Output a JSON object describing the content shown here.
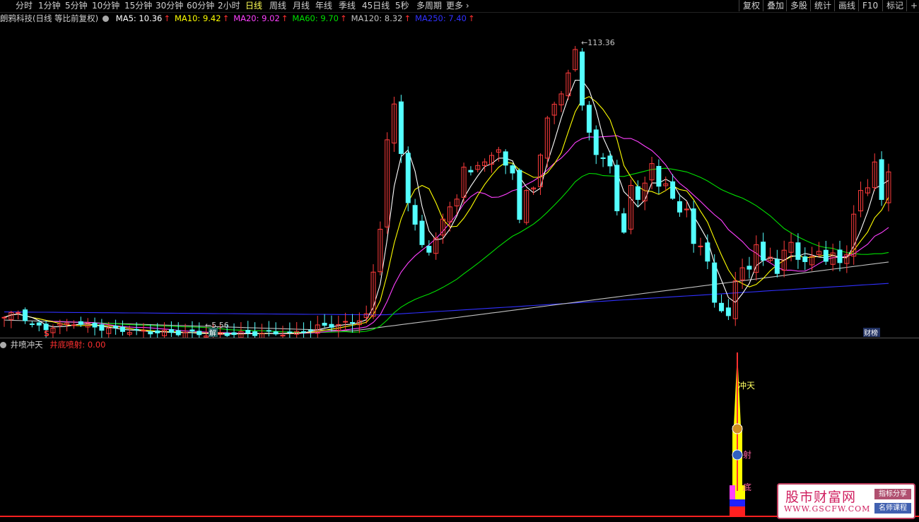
{
  "toolbar": {
    "periods": [
      {
        "label": "分时",
        "active": false
      },
      {
        "label": "1分钟",
        "active": false
      },
      {
        "label": "5分钟",
        "active": false
      },
      {
        "label": "10分钟",
        "active": false
      },
      {
        "label": "15分钟",
        "active": false
      },
      {
        "label": "30分钟",
        "active": false
      },
      {
        "label": "60分钟",
        "active": false
      },
      {
        "label": "2小时",
        "active": false
      },
      {
        "label": "日线",
        "active": true
      },
      {
        "label": "周线",
        "active": false
      },
      {
        "label": "月线",
        "active": false
      },
      {
        "label": "年线",
        "active": false
      },
      {
        "label": "季线",
        "active": false
      },
      {
        "label": "45日线",
        "active": false
      },
      {
        "label": "5秒",
        "active": false
      },
      {
        "label": "多周期",
        "active": false
      },
      {
        "label": "更多",
        "active": false
      }
    ],
    "right": [
      "复权",
      "叠加",
      "多股",
      "统计",
      "画线",
      "F10",
      "标记",
      "+自"
    ]
  },
  "legend": {
    "stock": "朗鸦科技(日线 等比前复权)",
    "ma": [
      {
        "label": "MA5: 10.36",
        "color": "#ffffff"
      },
      {
        "label": "MA10: 9.42",
        "color": "#ffff00"
      },
      {
        "label": "MA20: 9.02",
        "color": "#ff40ff"
      },
      {
        "label": "MA60: 9.70",
        "color": "#00e000"
      },
      {
        "label": "MA120: 8.32",
        "color": "#c0c0c0"
      },
      {
        "label": "MA250: 7.40",
        "color": "#3030ff"
      }
    ],
    "arrow": "↑"
  },
  "chart": {
    "high_label": "113.36",
    "low_label": "5.56",
    "marker_s": "S",
    "marker_jie": "解",
    "marker_caibang": "财榜",
    "colors": {
      "up": "#ff3c3c",
      "down": "#54ffff",
      "ma5": "#ffffff",
      "ma10": "#ffff00",
      "ma20": "#ff40ff",
      "ma60": "#00e000",
      "ma120": "#c0c0c0",
      "ma250": "#3030ff"
    }
  },
  "sub_legend": {
    "name": "井喷冲天",
    "value": "井底喷射: 0.00"
  },
  "sub_chart": {
    "label_chongtian": "冲天",
    "label_penshe": "射",
    "label_jingdi": "底"
  },
  "watermark": {
    "title": "股市财富网",
    "url": "WWW.GSCFW.COM",
    "badge1": "指标分享",
    "badge2": "名师课程"
  }
}
